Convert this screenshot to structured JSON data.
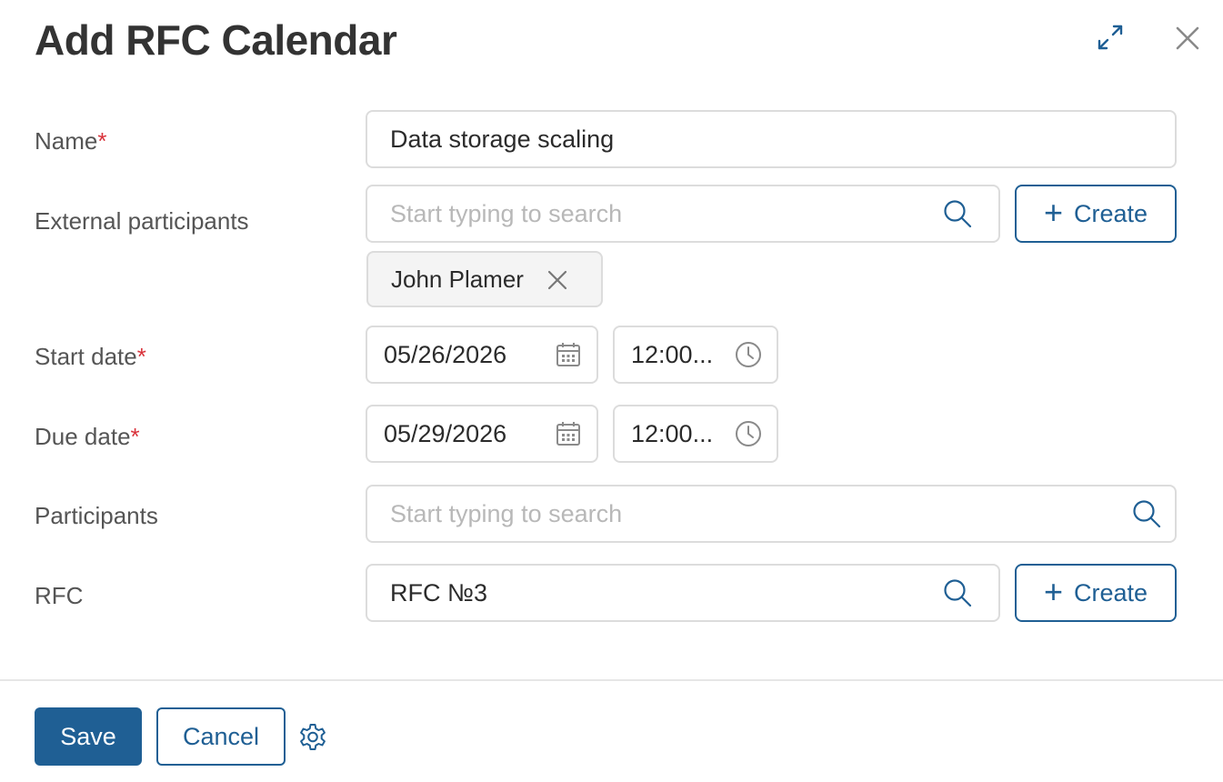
{
  "dialog": {
    "title": "Add RFC Calendar",
    "expand_icon": "expand-icon",
    "close_icon": "close-icon"
  },
  "form": {
    "name": {
      "label": "Name",
      "required_mark": "*",
      "value": "Data storage scaling"
    },
    "external_participants": {
      "label": "External participants",
      "placeholder": "Start typing to search",
      "create_label": "Create",
      "chips": [
        {
          "label": "John Plamer"
        }
      ]
    },
    "start_date": {
      "label": "Start date",
      "required_mark": "*",
      "date": "05/26/2026",
      "time": "12:00..."
    },
    "due_date": {
      "label": "Due date",
      "required_mark": "*",
      "date": "05/29/2026",
      "time": "12:00..."
    },
    "participants": {
      "label": "Participants",
      "placeholder": "Start typing to search"
    },
    "rfc": {
      "label": "RFC",
      "value": "RFC №3",
      "create_label": "Create"
    }
  },
  "footer": {
    "save_label": "Save",
    "cancel_label": "Cancel",
    "settings_icon": "gear-icon"
  },
  "colors": {
    "accent": "#1f5f94",
    "required": "#d9323a",
    "border": "#dcdcdc",
    "chip_bg": "#f4f4f4"
  }
}
